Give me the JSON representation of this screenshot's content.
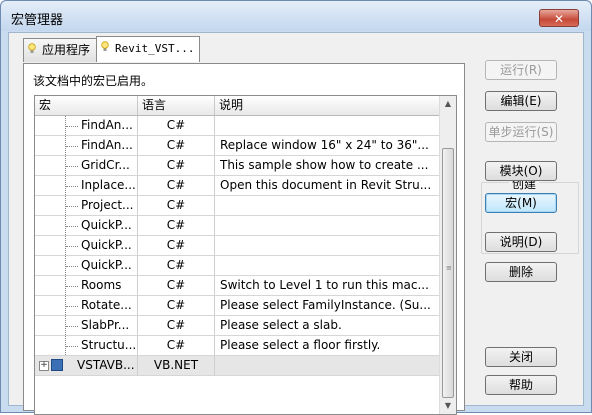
{
  "window": {
    "title": "宏管理器",
    "close_glyph": "✕"
  },
  "tabs": [
    {
      "label": "应用程序",
      "icon": "lightbulb-icon"
    },
    {
      "label": "Revit_VST...",
      "icon": "lightbulb-icon"
    }
  ],
  "info_text": "该文档中的宏已启用。",
  "table": {
    "columns": [
      "宏",
      "语言",
      "说明"
    ],
    "rows": [
      {
        "name": "FindAn...",
        "lang": "C#",
        "desc": ""
      },
      {
        "name": "FindAn...",
        "lang": "C#",
        "desc": "Replace window 16\" x 24\" to 36\"..."
      },
      {
        "name": "GridCr...",
        "lang": "C#",
        "desc": "This sample show how to create ..."
      },
      {
        "name": "Inplace...",
        "lang": "C#",
        "desc": "Open this document in Revit Stru..."
      },
      {
        "name": "Project...",
        "lang": "C#",
        "desc": ""
      },
      {
        "name": "QuickP...",
        "lang": "C#",
        "desc": ""
      },
      {
        "name": "QuickP...",
        "lang": "C#",
        "desc": ""
      },
      {
        "name": "QuickP...",
        "lang": "C#",
        "desc": ""
      },
      {
        "name": "Rooms",
        "lang": "C#",
        "desc": "Switch to Level 1 to run this mac..."
      },
      {
        "name": "Rotate...",
        "lang": "C#",
        "desc": "Please select FamilyInstance. (Su..."
      },
      {
        "name": "SlabPr...",
        "lang": "C#",
        "desc": "Please select a slab."
      },
      {
        "name": "Structu...",
        "lang": "C#",
        "desc": "Please select a floor firstly."
      }
    ],
    "group_row": {
      "expander": "+",
      "name": "VSTAVB...",
      "lang": "VB.NET",
      "desc": ""
    }
  },
  "buttons": {
    "run": "运行(R)",
    "edit": "编辑(E)",
    "step": "单步运行(S)",
    "create_label": "创建",
    "module": "模块(O)",
    "macro": "宏(M)",
    "description": "说明(D)",
    "delete": "删除",
    "close": "关闭",
    "help": "帮助"
  },
  "colors": {
    "title_bar": "#c3d7ee",
    "close_button": "#c64a39",
    "group_row": "#e6e6e6",
    "default_button": "#bee6fd"
  }
}
